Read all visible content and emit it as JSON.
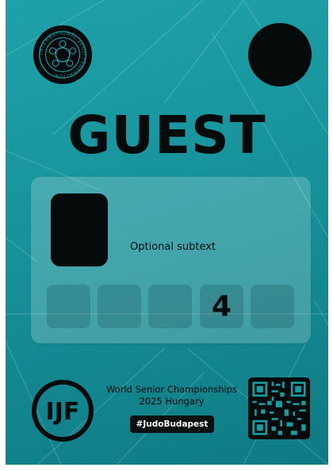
{
  "badge": {
    "federation_logo": "international-judo-federation-seal",
    "federation_name": "INTERNATIONAL JUDO FEDERATION",
    "title": "GUEST",
    "subtext": "Optional subtext",
    "access_slots": [
      "",
      "",
      "",
      "4",
      ""
    ],
    "ijf_logo": "IJF",
    "event_line1": "World Senior Championships",
    "event_line2": "2025 Hungary",
    "hashtag": "#JudoBudapest",
    "qr_icon": "qr-code-icon"
  },
  "colors": {
    "background_top": "#1fa1a9",
    "background_bottom": "#0f7a83",
    "ink": "#050a0b"
  }
}
